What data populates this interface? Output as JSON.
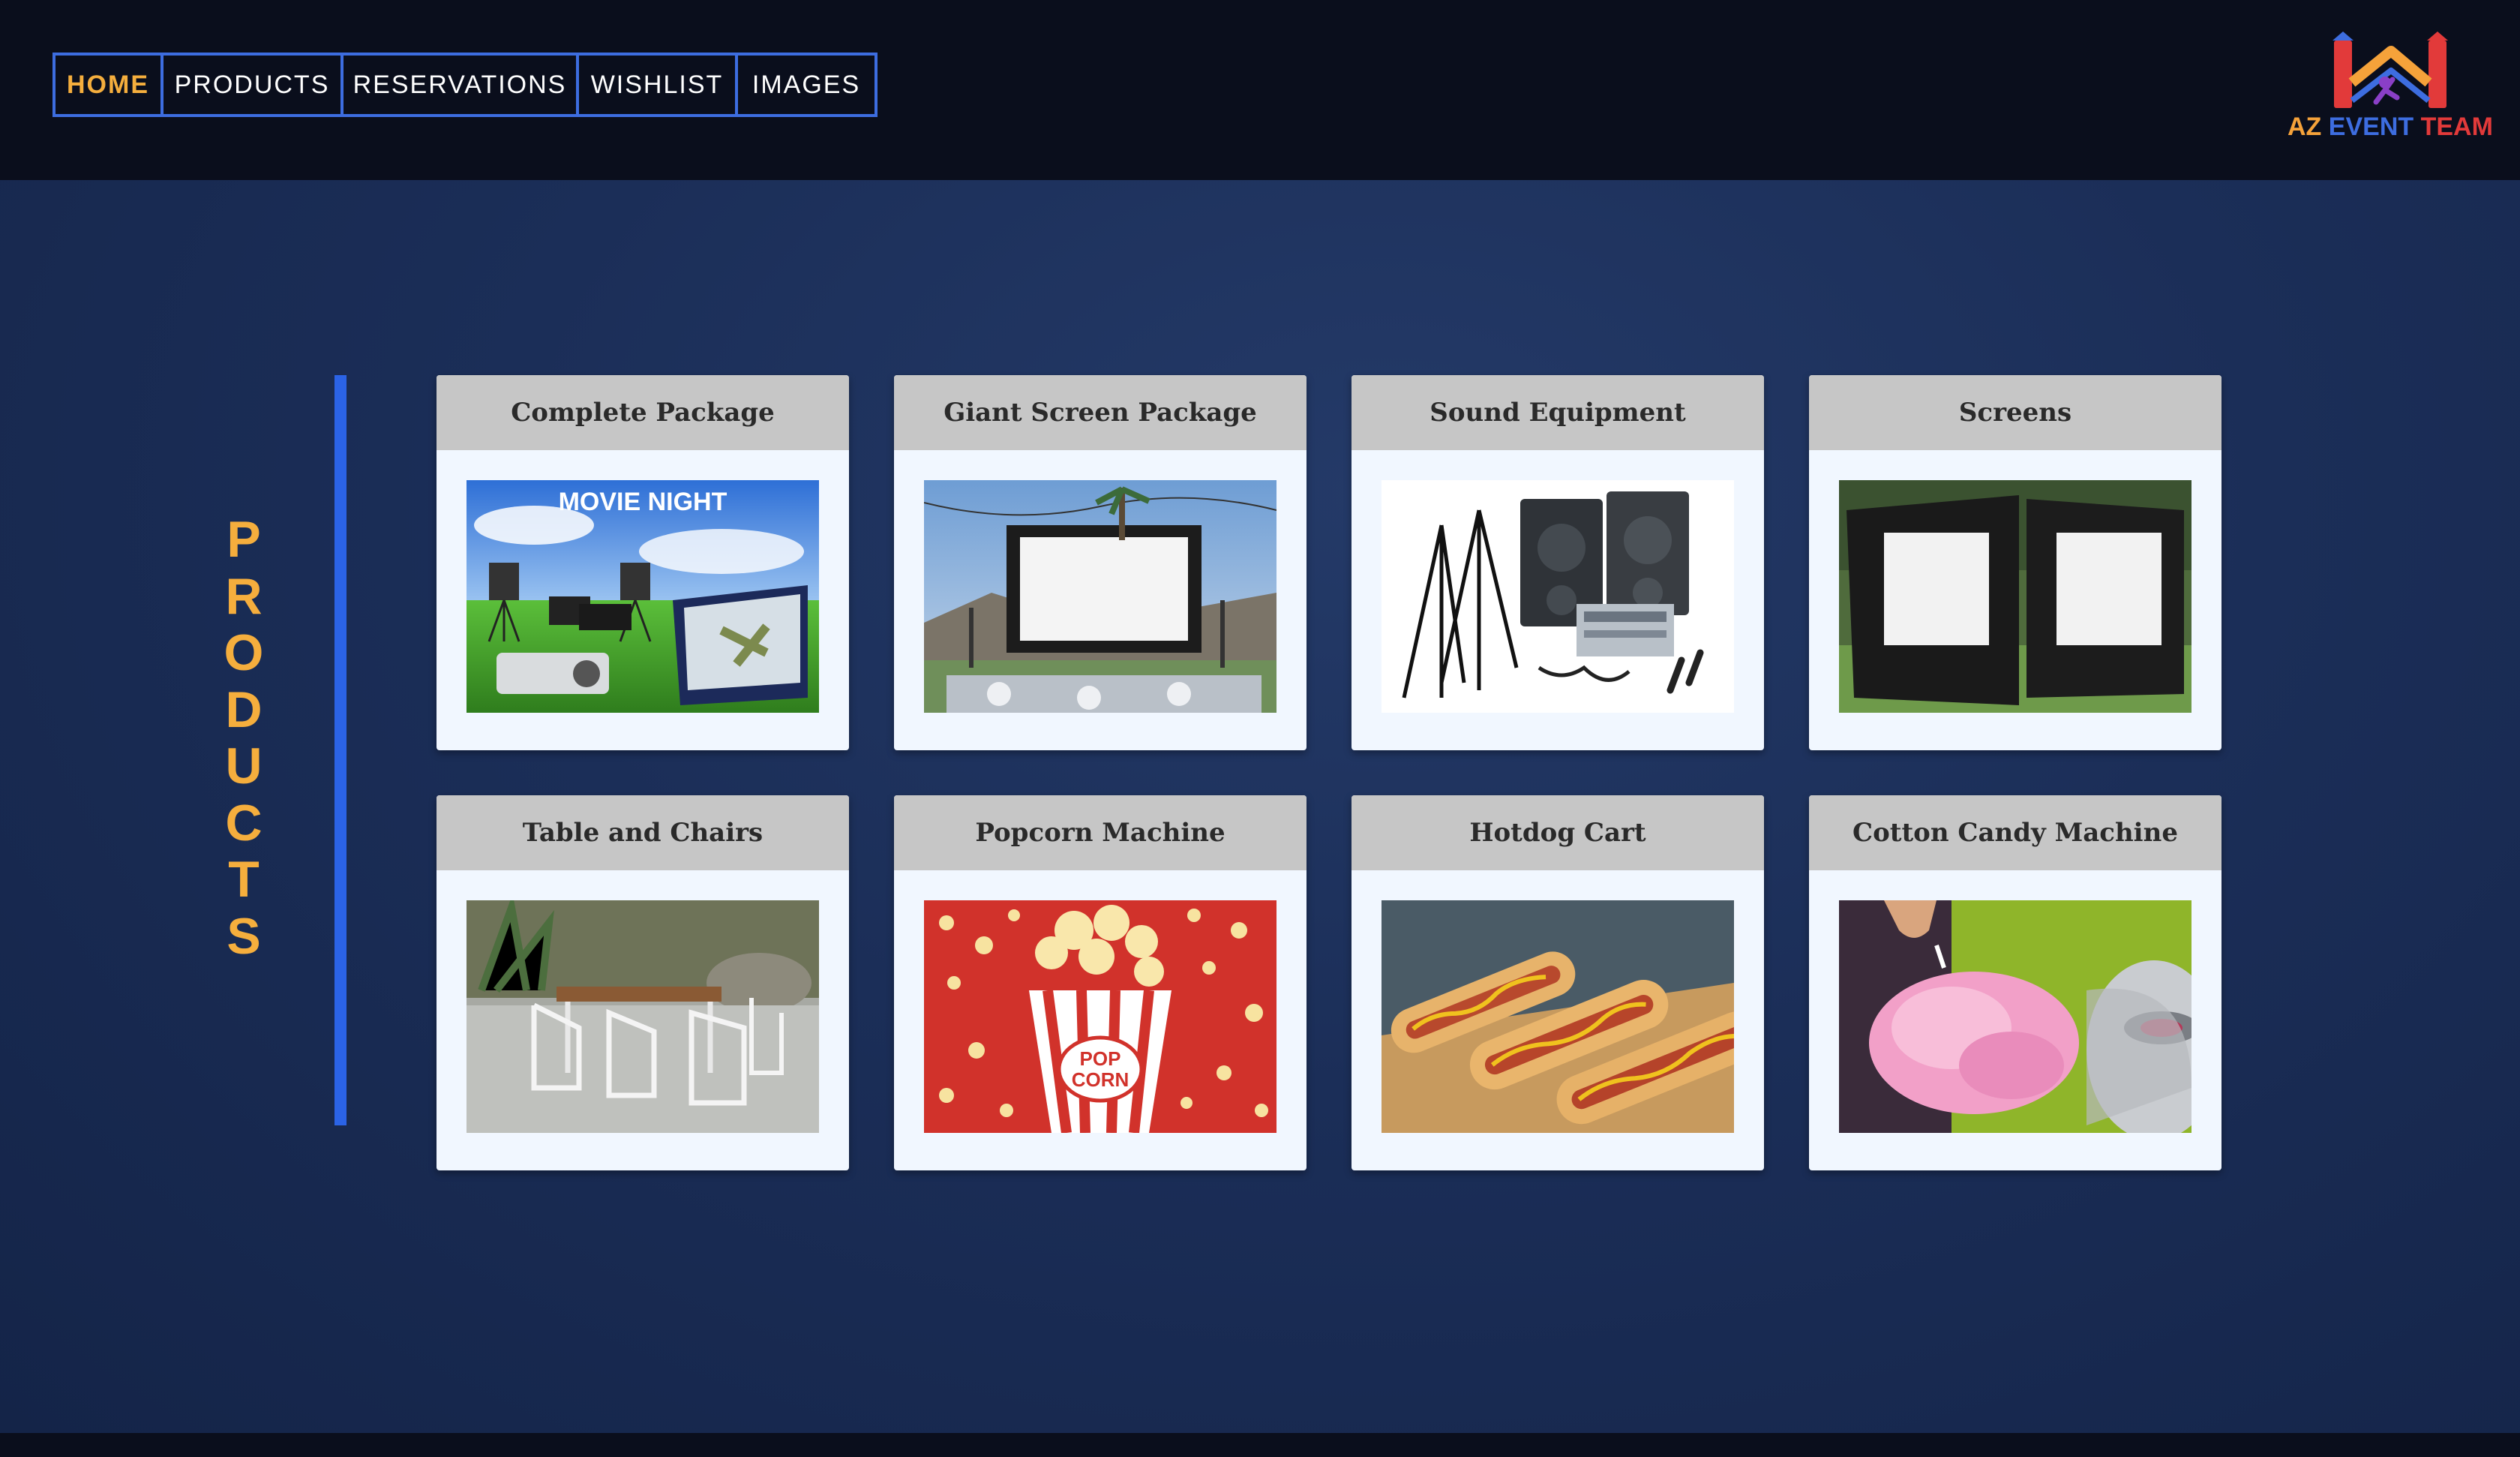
{
  "nav": {
    "items": [
      {
        "label": "HOME",
        "active": true
      },
      {
        "label": "PRODUCTS",
        "active": false
      },
      {
        "label": "RESERVATIONS",
        "active": false
      },
      {
        "label": "WISHLIST",
        "active": false
      },
      {
        "label": "IMAGES",
        "active": false
      }
    ]
  },
  "logo": {
    "icon": "bounce-house-icon",
    "az": "AZ",
    "event": "EVENT",
    "team": "TEAM",
    "colors": {
      "az": "#f5a23a",
      "event": "#3d6de0",
      "team": "#e23a3a"
    }
  },
  "page_title": "PRODUCTS",
  "products": [
    {
      "title": "Complete Package",
      "image": "movie-night-package-photo"
    },
    {
      "title": "Giant Screen Package",
      "image": "giant-outdoor-screen-photo"
    },
    {
      "title": "Sound Equipment",
      "image": "speakers-and-mixer-photo"
    },
    {
      "title": "Screens",
      "image": "inflatable-screens-photo"
    },
    {
      "title": "Table and Chairs",
      "image": "patio-table-chairs-photo"
    },
    {
      "title": "Popcorn Machine",
      "image": "popcorn-bucket-photo"
    },
    {
      "title": "Hotdog Cart",
      "image": "hotdogs-photo"
    },
    {
      "title": "Cotton Candy Machine",
      "image": "cotton-candy-photo"
    }
  ],
  "colors": {
    "header_bg": "#0a0e1c",
    "main_bg": "#1b2e58",
    "accent": "#f5ae3d",
    "nav_border": "#3d6de0",
    "side_bar": "#2b63e6",
    "card_bg": "#f1f7ff",
    "card_head": "#c6c6c6"
  }
}
